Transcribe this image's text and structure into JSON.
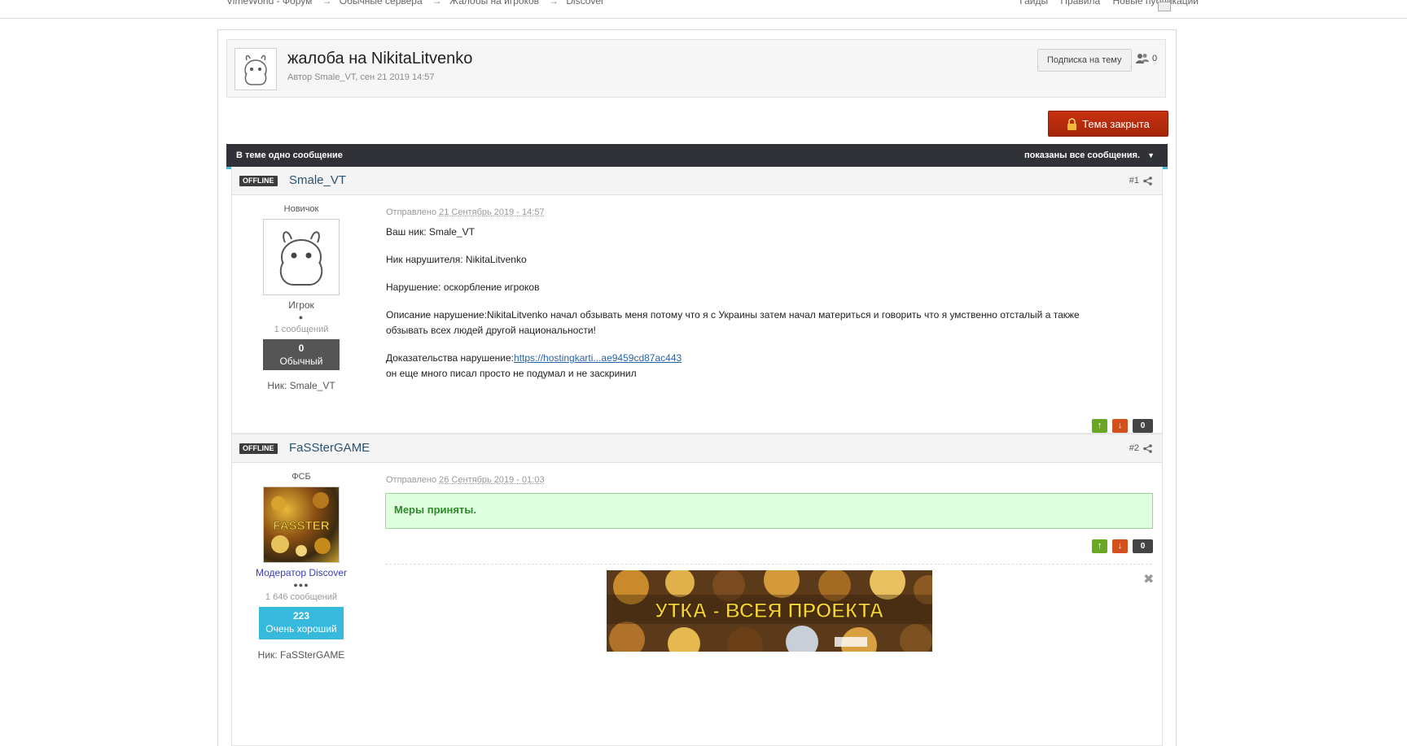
{
  "breadcrumb": [
    "VimeWorld - Форум",
    "Обычные сервера",
    "Жалобы на игроков",
    "Discover"
  ],
  "breadcrumb_sep": "→",
  "top_links": [
    "Гайды",
    "Правила",
    "Новые публикации"
  ],
  "topic": {
    "title": "жалоба на NikitaLitvenko",
    "subtitle": "Автор Smale_VT, сен 21 2019 14:57",
    "follow_label": "Подписка на тему",
    "followers_count": "0",
    "closed_label": "Тема закрыта"
  },
  "bar": {
    "left": "В теме одно сообщение",
    "right": "показаны все сообщения."
  },
  "posts": [
    {
      "status": "OFFLINE",
      "author": "Smale_VT",
      "number": "#1",
      "group": "Новичок",
      "rank": "Игрок",
      "pips": "●",
      "post_count": "1 сообщений",
      "rep_value": "0",
      "rep_label": "Обычный",
      "rep_color": "#555555",
      "nick": "Ник: Smale_VT",
      "meta_prefix": "Отправлено",
      "date": "21 Сентябрь 2019 - 14:57",
      "lines": {
        "l1": "Ваш ник: Smale_VT",
        "l2": "Ник нарушителя: NikitaLitvenko",
        "l3": "Нарушение: оскорбление игроков",
        "l4": "Описание нарушение:NikitaLitvenko начал обзывать меня потому что я с Украины затем начал материться и говорить что я умственно отсталый а также обзывать всех людей другой национальности!",
        "l5_prefix": "Доказательства нарушение:",
        "l5_link": "https://hostingkarti...ae9459cd87ac443",
        "l6": "он еще много писал просто не подумал и не заскринил"
      },
      "votes": {
        "up": "↑",
        "down": "↓",
        "score": "0"
      }
    },
    {
      "status": "OFFLINE",
      "author": "FaSSterGAME",
      "number": "#2",
      "group": "ФСБ",
      "rank": "Модератор Discover",
      "rank_color": "#3a3ab8",
      "pips": "●●●",
      "post_count": "1 646 сообщений",
      "rep_value": "223",
      "rep_label": "Очень хороший",
      "rep_color": "#37b8dd",
      "nick": "Ник: FaSSterGAME",
      "meta_prefix": "Отправлено",
      "date": "26 Сентябрь 2019 - 01:03",
      "message": "Меры приняты.",
      "votes": {
        "up": "↑",
        "down": "↓",
        "score": "0"
      },
      "avatar_text": "FASSTER",
      "signature_text": "УТКА - ВСЕЯ ПРОЕКТА"
    }
  ],
  "colors": {
    "bar_bg": "#303238",
    "bar_accent": "#4cb6dc",
    "closed_button": "#b52b0c",
    "author_link": "#2b5370",
    "success_bg": "#dfffdf"
  }
}
